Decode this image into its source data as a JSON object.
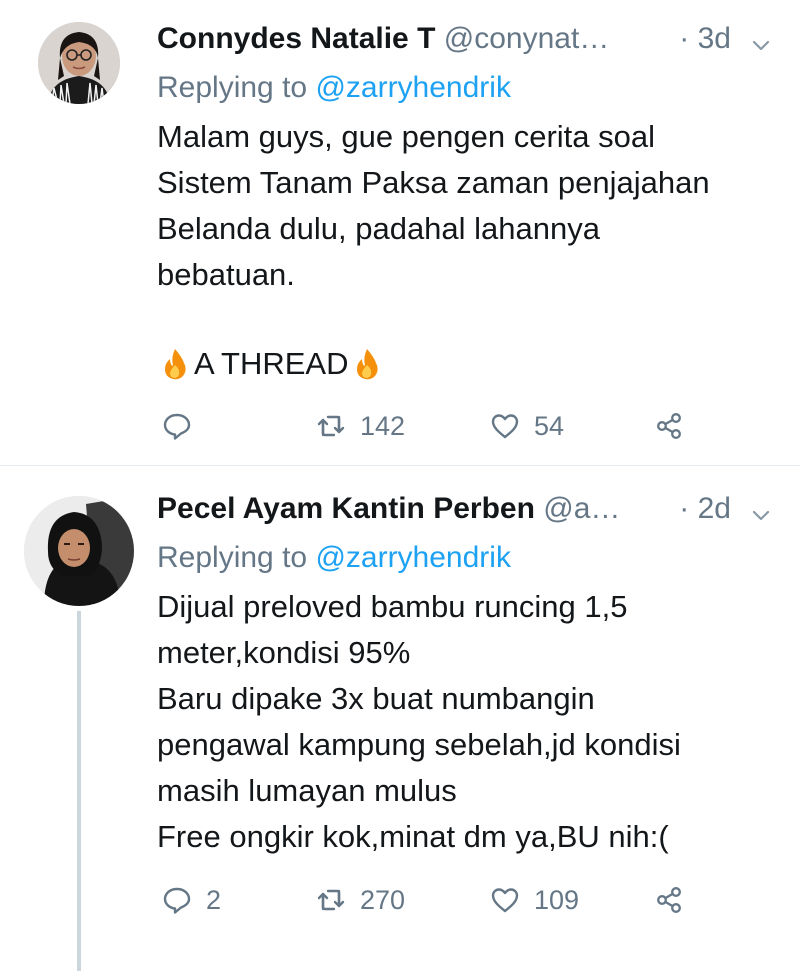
{
  "tweets": [
    {
      "name": "Connydes Natalie T",
      "handle": "@conynat…",
      "time": "· 3d",
      "replying_prefix": "Replying to",
      "replying_to": "@zarryhendrik",
      "body": "Malam guys, gue pengen cerita soal\nSistem Tanam Paksa zaman penjajahan\nBelanda dulu, padahal lahannya\nbebatuan.",
      "thread_label": "A THREAD",
      "reply_count": "",
      "retweet_count": "142",
      "like_count": "54"
    },
    {
      "name": "Pecel Ayam Kantin Perben",
      "handle": "@a…",
      "time": "· 2d",
      "replying_prefix": "Replying to",
      "replying_to": "@zarryhendrik",
      "body": "Dijual preloved bambu runcing 1,5\nmeter,kondisi 95%\nBaru dipake 3x buat numbangin\npengawal kampung sebelah,jd kondisi\nmasih lumayan mulus\nFree ongkir kok,minat dm ya,BU nih:(",
      "reply_count": "2",
      "retweet_count": "270",
      "like_count": "109"
    }
  ],
  "icons": {
    "reply": "reply-icon",
    "retweet": "retweet-icon",
    "like": "heart-icon",
    "share": "share-icon",
    "chevron": "chevron-down-icon",
    "fire": "fire-emoji"
  },
  "colors": {
    "text": "#14171a",
    "secondary": "#657786",
    "mention": "#1da1f2",
    "divider": "#e6ecf0",
    "thread_line": "#ccd6dd"
  }
}
